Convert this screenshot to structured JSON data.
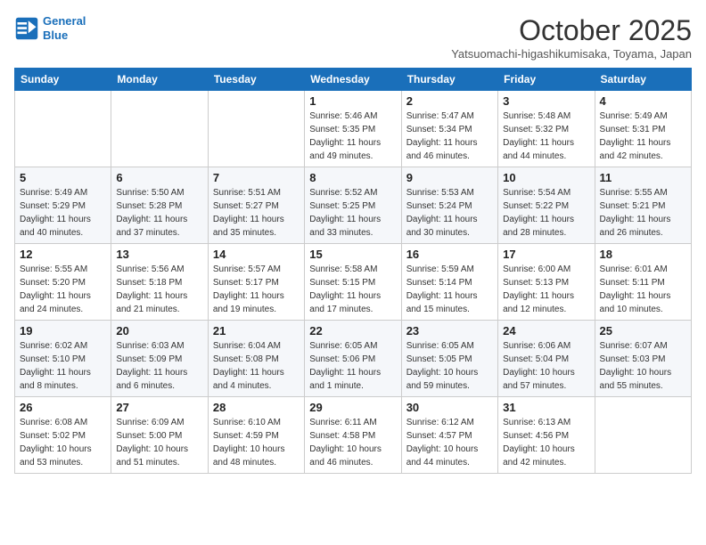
{
  "header": {
    "logo_line1": "General",
    "logo_line2": "Blue",
    "month": "October 2025",
    "location": "Yatsuomachi-higashikumisaka, Toyama, Japan"
  },
  "days_of_week": [
    "Sunday",
    "Monday",
    "Tuesday",
    "Wednesday",
    "Thursday",
    "Friday",
    "Saturday"
  ],
  "weeks": [
    [
      {
        "day": "",
        "info": ""
      },
      {
        "day": "",
        "info": ""
      },
      {
        "day": "",
        "info": ""
      },
      {
        "day": "1",
        "info": "Sunrise: 5:46 AM\nSunset: 5:35 PM\nDaylight: 11 hours\nand 49 minutes."
      },
      {
        "day": "2",
        "info": "Sunrise: 5:47 AM\nSunset: 5:34 PM\nDaylight: 11 hours\nand 46 minutes."
      },
      {
        "day": "3",
        "info": "Sunrise: 5:48 AM\nSunset: 5:32 PM\nDaylight: 11 hours\nand 44 minutes."
      },
      {
        "day": "4",
        "info": "Sunrise: 5:49 AM\nSunset: 5:31 PM\nDaylight: 11 hours\nand 42 minutes."
      }
    ],
    [
      {
        "day": "5",
        "info": "Sunrise: 5:49 AM\nSunset: 5:29 PM\nDaylight: 11 hours\nand 40 minutes."
      },
      {
        "day": "6",
        "info": "Sunrise: 5:50 AM\nSunset: 5:28 PM\nDaylight: 11 hours\nand 37 minutes."
      },
      {
        "day": "7",
        "info": "Sunrise: 5:51 AM\nSunset: 5:27 PM\nDaylight: 11 hours\nand 35 minutes."
      },
      {
        "day": "8",
        "info": "Sunrise: 5:52 AM\nSunset: 5:25 PM\nDaylight: 11 hours\nand 33 minutes."
      },
      {
        "day": "9",
        "info": "Sunrise: 5:53 AM\nSunset: 5:24 PM\nDaylight: 11 hours\nand 30 minutes."
      },
      {
        "day": "10",
        "info": "Sunrise: 5:54 AM\nSunset: 5:22 PM\nDaylight: 11 hours\nand 28 minutes."
      },
      {
        "day": "11",
        "info": "Sunrise: 5:55 AM\nSunset: 5:21 PM\nDaylight: 11 hours\nand 26 minutes."
      }
    ],
    [
      {
        "day": "12",
        "info": "Sunrise: 5:55 AM\nSunset: 5:20 PM\nDaylight: 11 hours\nand 24 minutes."
      },
      {
        "day": "13",
        "info": "Sunrise: 5:56 AM\nSunset: 5:18 PM\nDaylight: 11 hours\nand 21 minutes."
      },
      {
        "day": "14",
        "info": "Sunrise: 5:57 AM\nSunset: 5:17 PM\nDaylight: 11 hours\nand 19 minutes."
      },
      {
        "day": "15",
        "info": "Sunrise: 5:58 AM\nSunset: 5:15 PM\nDaylight: 11 hours\nand 17 minutes."
      },
      {
        "day": "16",
        "info": "Sunrise: 5:59 AM\nSunset: 5:14 PM\nDaylight: 11 hours\nand 15 minutes."
      },
      {
        "day": "17",
        "info": "Sunrise: 6:00 AM\nSunset: 5:13 PM\nDaylight: 11 hours\nand 12 minutes."
      },
      {
        "day": "18",
        "info": "Sunrise: 6:01 AM\nSunset: 5:11 PM\nDaylight: 11 hours\nand 10 minutes."
      }
    ],
    [
      {
        "day": "19",
        "info": "Sunrise: 6:02 AM\nSunset: 5:10 PM\nDaylight: 11 hours\nand 8 minutes."
      },
      {
        "day": "20",
        "info": "Sunrise: 6:03 AM\nSunset: 5:09 PM\nDaylight: 11 hours\nand 6 minutes."
      },
      {
        "day": "21",
        "info": "Sunrise: 6:04 AM\nSunset: 5:08 PM\nDaylight: 11 hours\nand 4 minutes."
      },
      {
        "day": "22",
        "info": "Sunrise: 6:05 AM\nSunset: 5:06 PM\nDaylight: 11 hours\nand 1 minute."
      },
      {
        "day": "23",
        "info": "Sunrise: 6:05 AM\nSunset: 5:05 PM\nDaylight: 10 hours\nand 59 minutes."
      },
      {
        "day": "24",
        "info": "Sunrise: 6:06 AM\nSunset: 5:04 PM\nDaylight: 10 hours\nand 57 minutes."
      },
      {
        "day": "25",
        "info": "Sunrise: 6:07 AM\nSunset: 5:03 PM\nDaylight: 10 hours\nand 55 minutes."
      }
    ],
    [
      {
        "day": "26",
        "info": "Sunrise: 6:08 AM\nSunset: 5:02 PM\nDaylight: 10 hours\nand 53 minutes."
      },
      {
        "day": "27",
        "info": "Sunrise: 6:09 AM\nSunset: 5:00 PM\nDaylight: 10 hours\nand 51 minutes."
      },
      {
        "day": "28",
        "info": "Sunrise: 6:10 AM\nSunset: 4:59 PM\nDaylight: 10 hours\nand 48 minutes."
      },
      {
        "day": "29",
        "info": "Sunrise: 6:11 AM\nSunset: 4:58 PM\nDaylight: 10 hours\nand 46 minutes."
      },
      {
        "day": "30",
        "info": "Sunrise: 6:12 AM\nSunset: 4:57 PM\nDaylight: 10 hours\nand 44 minutes."
      },
      {
        "day": "31",
        "info": "Sunrise: 6:13 AM\nSunset: 4:56 PM\nDaylight: 10 hours\nand 42 minutes."
      },
      {
        "day": "",
        "info": ""
      }
    ]
  ]
}
